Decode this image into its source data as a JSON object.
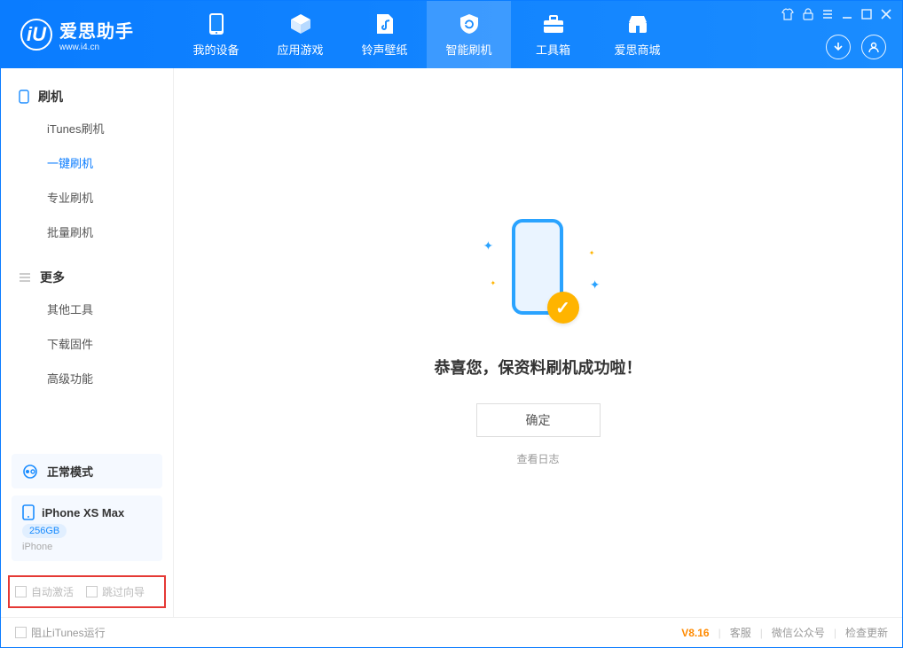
{
  "app": {
    "title": "爱思助手",
    "site": "www.i4.cn"
  },
  "nav": {
    "tabs": [
      {
        "label": "我的设备"
      },
      {
        "label": "应用游戏"
      },
      {
        "label": "铃声壁纸"
      },
      {
        "label": "智能刷机"
      },
      {
        "label": "工具箱"
      },
      {
        "label": "爱思商城"
      }
    ],
    "active_index": 3
  },
  "sidebar": {
    "group1_title": "刷机",
    "items1": [
      {
        "label": "iTunes刷机"
      },
      {
        "label": "一键刷机"
      },
      {
        "label": "专业刷机"
      },
      {
        "label": "批量刷机"
      }
    ],
    "active_item1_index": 1,
    "group2_title": "更多",
    "items2": [
      {
        "label": "其他工具"
      },
      {
        "label": "下载固件"
      },
      {
        "label": "高级功能"
      }
    ],
    "mode_label": "正常模式",
    "device": {
      "name": "iPhone XS Max",
      "storage": "256GB",
      "type": "iPhone"
    },
    "check_auto_activate": "自动激活",
    "check_skip_wizard": "跳过向导"
  },
  "main": {
    "message": "恭喜您，保资料刷机成功啦！",
    "ok_label": "确定",
    "log_label": "查看日志"
  },
  "footer": {
    "block_itunes": "阻止iTunes运行",
    "version": "V8.16",
    "support": "客服",
    "wechat": "微信公众号",
    "update": "检查更新"
  }
}
